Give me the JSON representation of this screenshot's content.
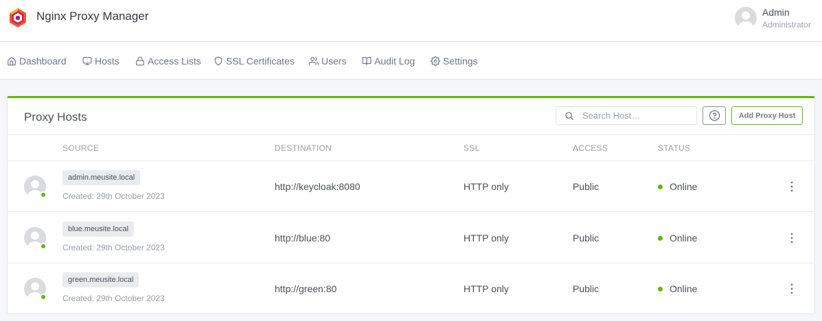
{
  "app": {
    "title": "Nginx Proxy Manager"
  },
  "user": {
    "name": "Admin",
    "role": "Administrator"
  },
  "nav": [
    {
      "label": "Dashboard",
      "icon": "home-icon"
    },
    {
      "label": "Hosts",
      "icon": "monitor-icon"
    },
    {
      "label": "Access Lists",
      "icon": "lock-icon"
    },
    {
      "label": "SSL Certificates",
      "icon": "shield-icon"
    },
    {
      "label": "Users",
      "icon": "users-icon"
    },
    {
      "label": "Audit Log",
      "icon": "book-icon"
    },
    {
      "label": "Settings",
      "icon": "gear-icon"
    }
  ],
  "card": {
    "title": "Proxy Hosts",
    "search_placeholder": "Search Host…",
    "add_button": "Add Proxy Host",
    "accent_color": "#5eba00"
  },
  "table": {
    "headers": {
      "source": "SOURCE",
      "destination": "DESTINATION",
      "ssl": "SSL",
      "access": "ACCESS",
      "status": "STATUS"
    },
    "rows": [
      {
        "domain": "admin.meusite.local",
        "created": "Created: 29th October 2023",
        "destination": "http://keycloak:8080",
        "ssl": "HTTP only",
        "access": "Public",
        "status": "Online"
      },
      {
        "domain": "blue.meusite.local",
        "created": "Created: 29th October 2023",
        "destination": "http://blue:80",
        "ssl": "HTTP only",
        "access": "Public",
        "status": "Online"
      },
      {
        "domain": "green.meusite.local",
        "created": "Created: 29th October 2023",
        "destination": "http://green:80",
        "ssl": "HTTP only",
        "access": "Public",
        "status": "Online"
      }
    ]
  }
}
